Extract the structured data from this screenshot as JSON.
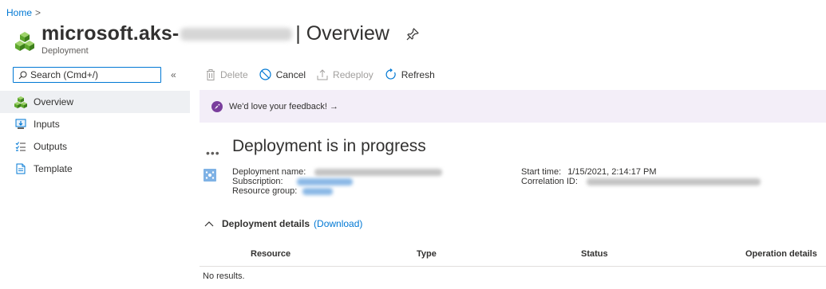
{
  "breadcrumb": {
    "home": "Home",
    "separator": ">"
  },
  "header": {
    "title_prefix": "microsoft.aks-",
    "title_suffix": "| Overview",
    "subtitle": "Deployment",
    "pin_icon": "pin-icon"
  },
  "sidebar": {
    "search_placeholder": "Search (Cmd+/)",
    "collapse_label": "«",
    "items": [
      {
        "label": "Overview",
        "icon": "overview-cubes-icon",
        "active": true
      },
      {
        "label": "Inputs",
        "icon": "inputs-icon"
      },
      {
        "label": "Outputs",
        "icon": "outputs-icon"
      },
      {
        "label": "Template",
        "icon": "template-icon"
      }
    ]
  },
  "toolbar": {
    "delete_label": "Delete",
    "cancel_label": "Cancel",
    "redeploy_label": "Redeploy",
    "refresh_label": "Refresh"
  },
  "feedback": {
    "text": "We'd love your feedback! →"
  },
  "status": {
    "dots": "•••",
    "title": "Deployment is in progress"
  },
  "info": {
    "deployment_name_label": "Deployment name:",
    "subscription_label": "Subscription:",
    "resource_group_label": "Resource group:",
    "start_time_label": "Start time:",
    "start_time_value": "1/15/2021, 2:14:17 PM",
    "correlation_id_label": "Correlation ID:"
  },
  "details": {
    "title": "Deployment details",
    "download_label": "(Download)"
  },
  "grid": {
    "columns": [
      "Resource",
      "Type",
      "Status",
      "Operation details"
    ],
    "empty_text": "No results."
  },
  "colors": {
    "accent": "#0078d4",
    "feedback_bg": "#f3eef8",
    "active_nav": "#eef0f3"
  }
}
